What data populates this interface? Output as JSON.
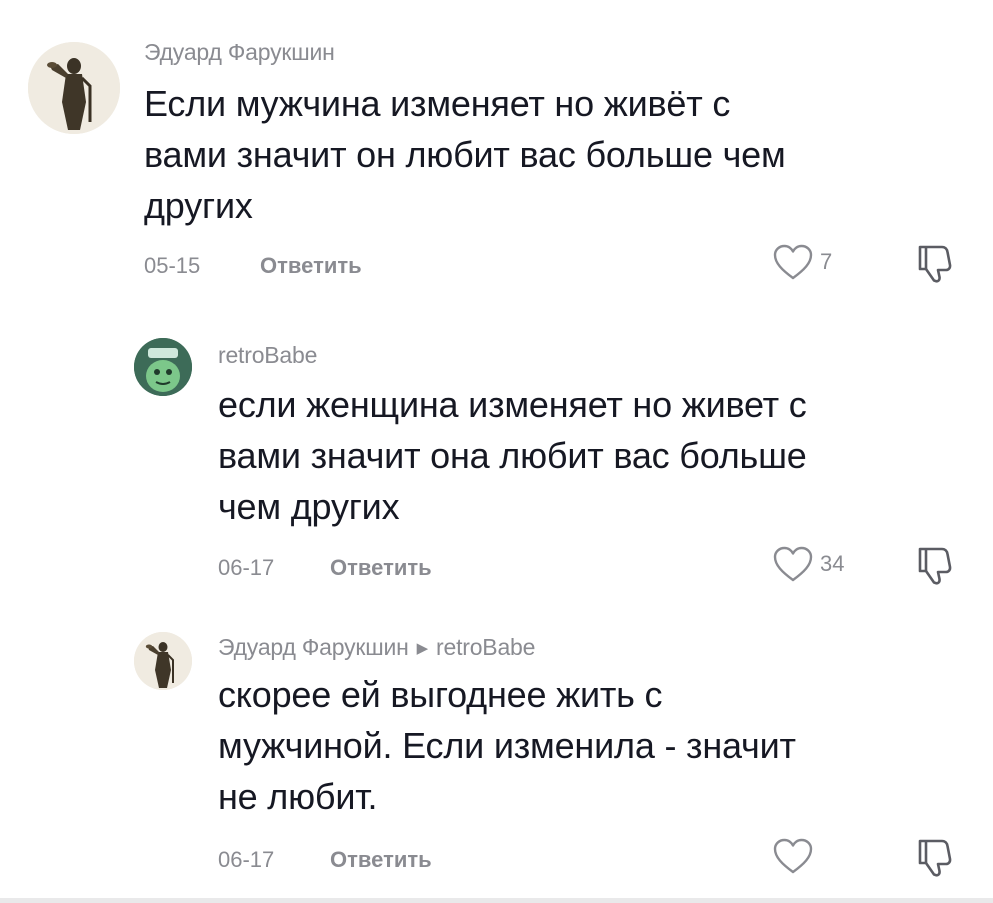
{
  "comments": [
    {
      "author": "Эдуард Фарукшин",
      "text_lines": [
        "Если мужчина изменяет но живёт с",
        "вами значит он любит вас больше чем",
        "других"
      ],
      "date": "05-15",
      "reply_label": "Ответить",
      "like_count": "7",
      "avatar_icon": "statue-avatar-icon"
    },
    {
      "author": "retroBabe",
      "text_lines": [
        "если женщина изменяет но живет с",
        "вами значит она любит вас больше",
        "чем других"
      ],
      "date": "06-17",
      "reply_label": "Ответить",
      "like_count": "34",
      "avatar_icon": "green-character-avatar-icon"
    },
    {
      "author": "Эдуард Фарукшин",
      "reply_to": "retroBabe",
      "text_lines": [
        "скорее ей выгоднее жить с",
        "мужчиной. Если изменила - значит",
        "не любит."
      ],
      "date": "06-17",
      "reply_label": "Ответить",
      "like_count": "",
      "avatar_icon": "statue-avatar-icon"
    }
  ],
  "colors": {
    "text": "#161823",
    "secondary": "#8a8b91",
    "background": "#ffffff"
  }
}
